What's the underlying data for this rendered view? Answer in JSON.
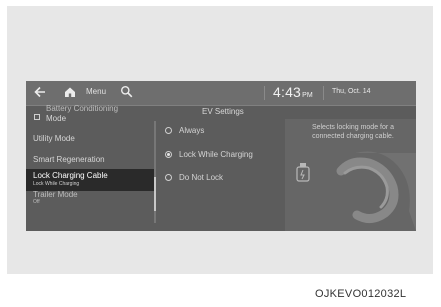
{
  "topbar": {
    "menu_label": "Menu",
    "time": "4:43",
    "ampm": "PM",
    "date": "Thu, Oct. 14"
  },
  "page_title": "EV Settings",
  "left_menu": [
    {
      "label": "Battery Conditioning",
      "line2": "Mode",
      "has_checkbox": true
    },
    {
      "label": "Utility Mode"
    },
    {
      "label": "Smart Regeneration"
    },
    {
      "label": "Lock Charging Cable",
      "sub": "Lock While Charging",
      "selected": true
    },
    {
      "label": "Trailer Mode",
      "sub": "Off"
    }
  ],
  "options": [
    {
      "label": "Always",
      "selected": false
    },
    {
      "label": "Lock While Charging",
      "selected": true
    },
    {
      "label": "Do Not Lock",
      "selected": false
    }
  ],
  "info": {
    "hint": "Selects locking mode for a connected charging cable."
  },
  "caption": "OJKEVO012032L"
}
